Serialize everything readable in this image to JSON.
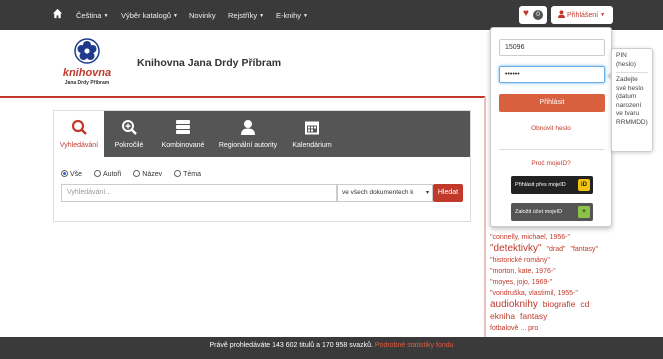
{
  "topnav": {
    "items": [
      "Čeština",
      "Výběr katalogů",
      "Novinky",
      "Rejstříky",
      "E-knihy"
    ],
    "favorites_count": "0",
    "login_label": "Přihlášení"
  },
  "header": {
    "logo_line1": "knihovna",
    "logo_line2": "Jana Drdy Příbram",
    "site_title": "Knihovna Jana Drdy Příbram"
  },
  "search": {
    "tabs": [
      "Vyhledávání",
      "Pokročilé",
      "Kombinované",
      "Regionální autority",
      "Kalendárium"
    ],
    "radios": [
      "Vše",
      "Autoři",
      "Název",
      "Téma"
    ],
    "placeholder": "Vyhledávání...",
    "scope": "ve všech dokumentech k",
    "button": "Hledat"
  },
  "login_dropdown": {
    "username_value": "15096",
    "password_value": "••••••",
    "login_button": "Přihlásit",
    "renew_password": "Obnovit heslo",
    "why_mojeid": "Proč mojeID?",
    "login_mojeid": "Přihlásit přes mojeID",
    "create_mojeid": "Založit účet mojeID"
  },
  "tooltip": {
    "title": "PIN (heslo)",
    "body": "Zadejte své heslo (datum narození ve tvaru RRMMDD)"
  },
  "tagcloud": {
    "tags": [
      {
        "t": "\"connelly, michael, 1956-\"",
        "s": "small"
      },
      {
        "t": "\"detektivky\"",
        "s": "big"
      },
      {
        "t": "\"drad\"",
        "s": "small"
      },
      {
        "t": "\"fantasy\"",
        "s": "small"
      },
      {
        "t": "\"historické romány\"",
        "s": "small"
      },
      {
        "t": "\"morton, kate, 1976-\"",
        "s": "small"
      },
      {
        "t": "\"moyes, jojo, 1969-\"",
        "s": "small"
      },
      {
        "t": "\"vondruška, vlastimil, 1955-\"",
        "s": "small"
      },
      {
        "t": "audioknihy",
        "s": "big"
      },
      {
        "t": "biografie",
        "s": "mid"
      },
      {
        "t": "cd",
        "s": "mid"
      },
      {
        "t": "ekniha",
        "s": "mid"
      },
      {
        "t": "fantasy",
        "s": "mid"
      },
      {
        "t": "fotbalově ... pro",
        "s": "small"
      }
    ]
  },
  "footer": {
    "text": "Právě prohledáváte 143 602 titulů a 170 958 svazků.",
    "link": "Podrobné statistiky fondu"
  },
  "colors": {
    "accent": "#c0392b",
    "nav": "#3a3a3a",
    "tabs": "#555555"
  }
}
